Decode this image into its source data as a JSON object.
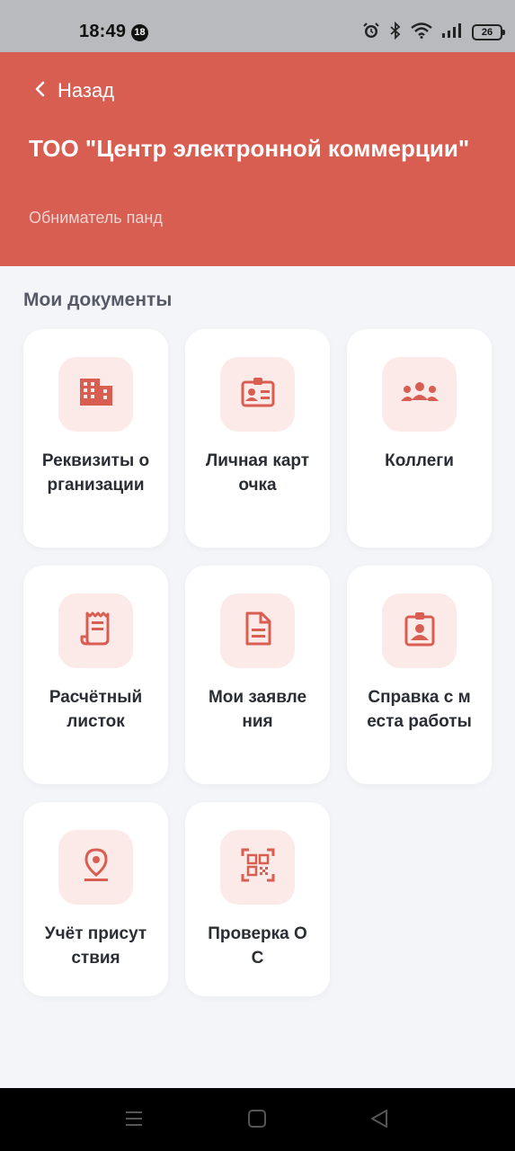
{
  "status_bar": {
    "time": "18:49",
    "notification_count": "18",
    "battery": "26",
    "icons": [
      "alarm-icon",
      "bluetooth-icon",
      "wifi-icon",
      "signal-icon",
      "battery-icon"
    ]
  },
  "header": {
    "back_label": "Назад",
    "title": "ТОО \"Центр электронной коммерции\"",
    "subtitle": "Обниматель панд",
    "background_color": "#d85e52"
  },
  "section": {
    "title": "Мои документы"
  },
  "cards": [
    {
      "label": "Реквизиты организации",
      "icon": "building-icon"
    },
    {
      "label": "Личная карточка",
      "icon": "id-badge-icon"
    },
    {
      "label": "Коллеги",
      "icon": "people-icon"
    },
    {
      "label": "Расчётный листок",
      "icon": "receipt-icon"
    },
    {
      "label": "Мои заявления",
      "icon": "document-icon"
    },
    {
      "label": "Справка с места работы",
      "icon": "certificate-icon"
    },
    {
      "label": "Учёт присутствия",
      "icon": "location-pin-icon"
    },
    {
      "label": "Проверка ОС",
      "icon": "qr-code-icon"
    }
  ],
  "colors": {
    "accent": "#d85e52",
    "icon_bg": "#fbeae8",
    "page_bg": "#f4f5f9"
  },
  "nav_bar": {
    "buttons": [
      "menu-icon",
      "home-icon",
      "back-triangle-icon"
    ]
  }
}
